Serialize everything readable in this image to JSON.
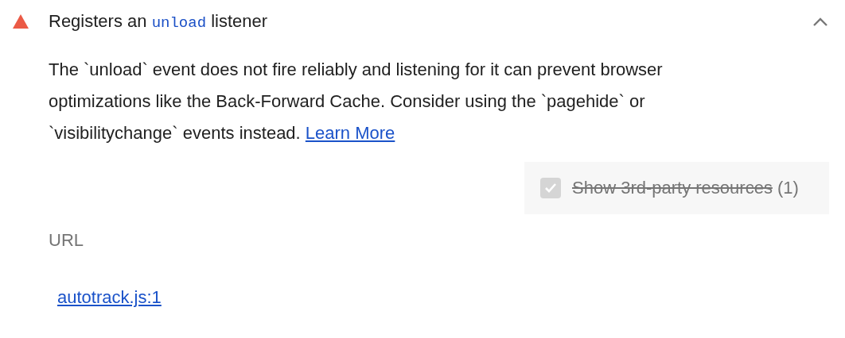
{
  "audit": {
    "failing": true,
    "expanded": true,
    "title": {
      "before": "Registers an",
      "code": "unload",
      "after": "listener"
    },
    "description": {
      "text": "The `unload` event does not fire reliably and listening for it can prevent browser optimizations like the Back-Forward Cache. Consider using the `pagehide` or `visibilitychange` events instead.",
      "link": "Learn More"
    },
    "third_party_filter": {
      "label": "Show 3rd-party resources",
      "count": "(1)",
      "checked": true,
      "disabled": true
    },
    "table": {
      "columns": [
        "URL"
      ],
      "rows": [
        {
          "url": "autotrack.js:1"
        }
      ]
    }
  }
}
